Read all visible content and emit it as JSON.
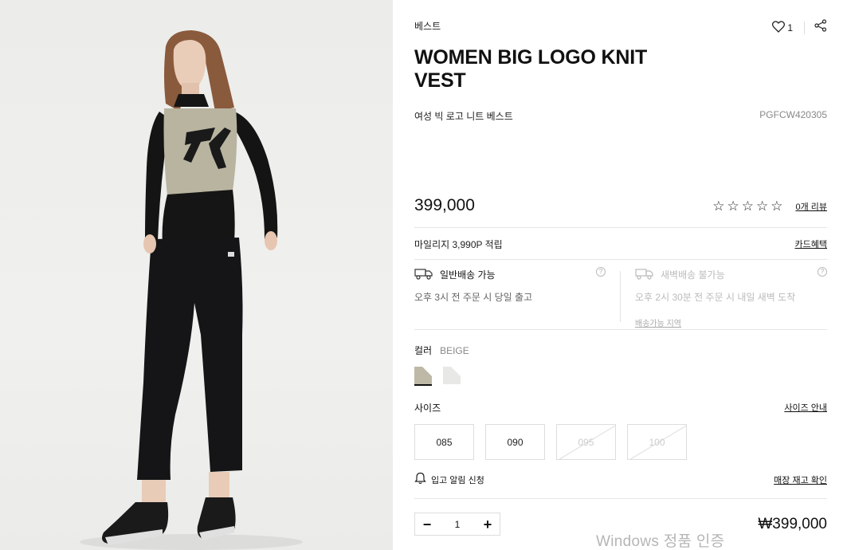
{
  "product": {
    "category": "베스트",
    "title": "WOMEN BIG LOGO KNIT VEST",
    "subtitle": "여성 빅 로고 니트 베스트",
    "code": "PGFCW420305",
    "like_count": "1",
    "price": "399,000",
    "stars": [
      "☆",
      "☆",
      "☆",
      "☆",
      "☆"
    ],
    "review_link": "0개 리뷰",
    "mileage": "마일리지 3,990P 적립",
    "card_benefit": "카드혜택"
  },
  "shipping": {
    "normal": {
      "title": "일반배송 가능",
      "desc": "오후 3시 전 주문 시 당일 출고"
    },
    "dawn": {
      "title": "새벽배송 불가능",
      "desc": "오후 2시 30분 전 주문 시 내일 새벽 도착",
      "link": "배송가능 지역"
    }
  },
  "color": {
    "label": "컬러",
    "value": "BEIGE",
    "swatches": [
      {
        "name": "beige",
        "hex": "#bdb9a6",
        "selected": true
      },
      {
        "name": "white",
        "hex": "#e8e8e6",
        "selected": false
      }
    ]
  },
  "size": {
    "label": "사이즈",
    "guide": "사이즈 안내",
    "options": [
      {
        "label": "085",
        "available": true
      },
      {
        "label": "090",
        "available": true
      },
      {
        "label": "095",
        "available": false
      },
      {
        "label": "100",
        "available": false
      }
    ]
  },
  "restock": {
    "label": "입고 알림 신청",
    "store_stock": "매장 재고 확인"
  },
  "order": {
    "quantity": "1",
    "minus": "−",
    "plus": "+",
    "total": "₩399,000"
  },
  "os_watermark": "Windows 정품 인증"
}
